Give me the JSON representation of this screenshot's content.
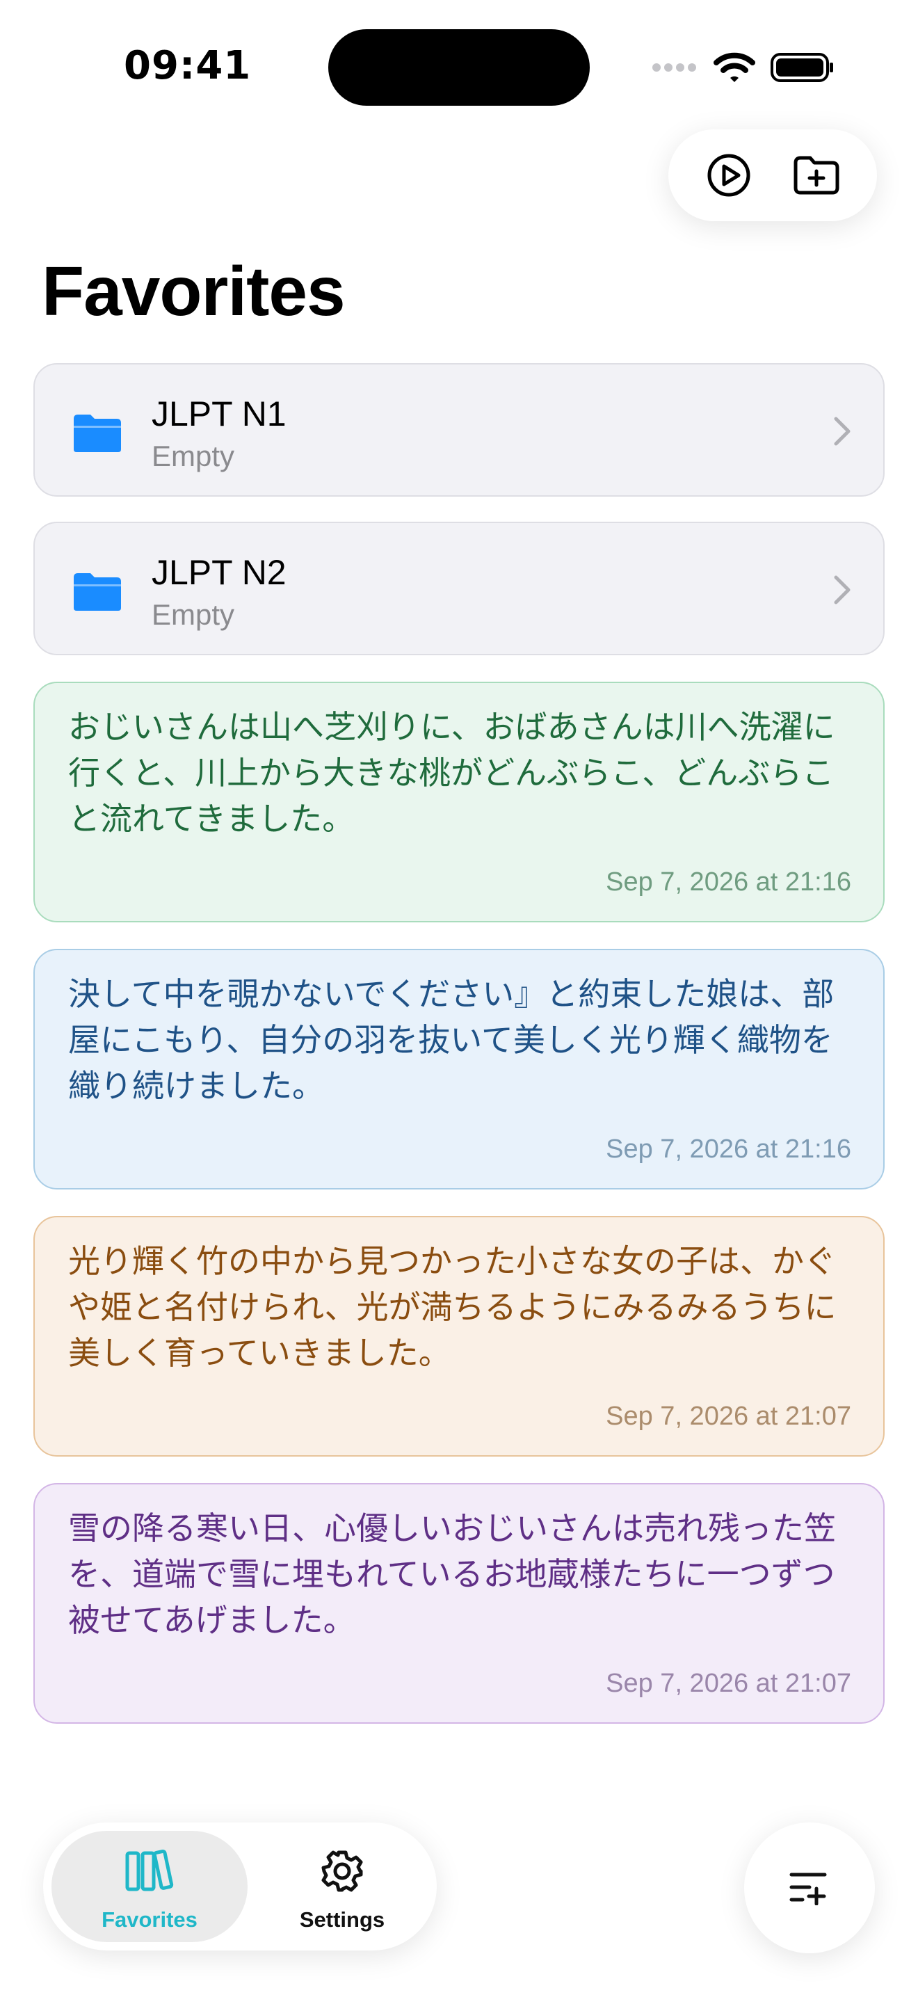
{
  "status_bar": {
    "time": "09:41"
  },
  "page": {
    "title": "Favorites"
  },
  "folders": [
    {
      "name": "JLPT N1",
      "subtitle": "Empty"
    },
    {
      "name": "JLPT N2",
      "subtitle": "Empty"
    }
  ],
  "notes": [
    {
      "text": "おじいさんは山へ芝刈りに、おばあさんは川へ洗濯に行くと、川上から大きな桃がどんぶらこ、どんぶらこと流れてきました。",
      "date": "Sep 7, 2026 at 21:16",
      "color": "green"
    },
    {
      "text": "決して中を覗かないでください』と約束した娘は、部屋にこもり、自分の羽を抜いて美しく光り輝く織物を織り続けました。",
      "date": "Sep 7, 2026 at 21:16",
      "color": "blue"
    },
    {
      "text": "光り輝く竹の中から見つかった小さな女の子は、かぐや姫と名付けられ、光が満ちるようにみるみるうちに美しく育っていきました。",
      "date": "Sep 7, 2026 at 21:07",
      "color": "orange"
    },
    {
      "text": "雪の降る寒い日、心優しいおじいさんは売れ残った笠を、道端で雪に埋もれているお地蔵様たちに一つずつ被せてあげました。",
      "date": "Sep 7, 2026 at 21:07",
      "color": "purple"
    }
  ],
  "tabbar": {
    "tabs": [
      {
        "label": "Favorites",
        "icon": "books-icon",
        "active": true
      },
      {
        "label": "Settings",
        "icon": "gear-icon",
        "active": false
      }
    ]
  },
  "icons": {
    "top_actions": [
      "play-circle-icon",
      "folder-plus-icon"
    ],
    "fab": "list-add-icon"
  },
  "colors": {
    "accent_teal": "#1fb7c8",
    "folder_blue": "#1a8cff",
    "note_green_bg": "#e9f6ee",
    "note_green_text": "#1f6b3c",
    "note_blue_bg": "#e8f2fb",
    "note_blue_text": "#1f5287",
    "note_orange_bg": "#faf0e6",
    "note_orange_text": "#8a4d10",
    "note_purple_bg": "#f3ecf9",
    "note_purple_text": "#5f2f86"
  }
}
